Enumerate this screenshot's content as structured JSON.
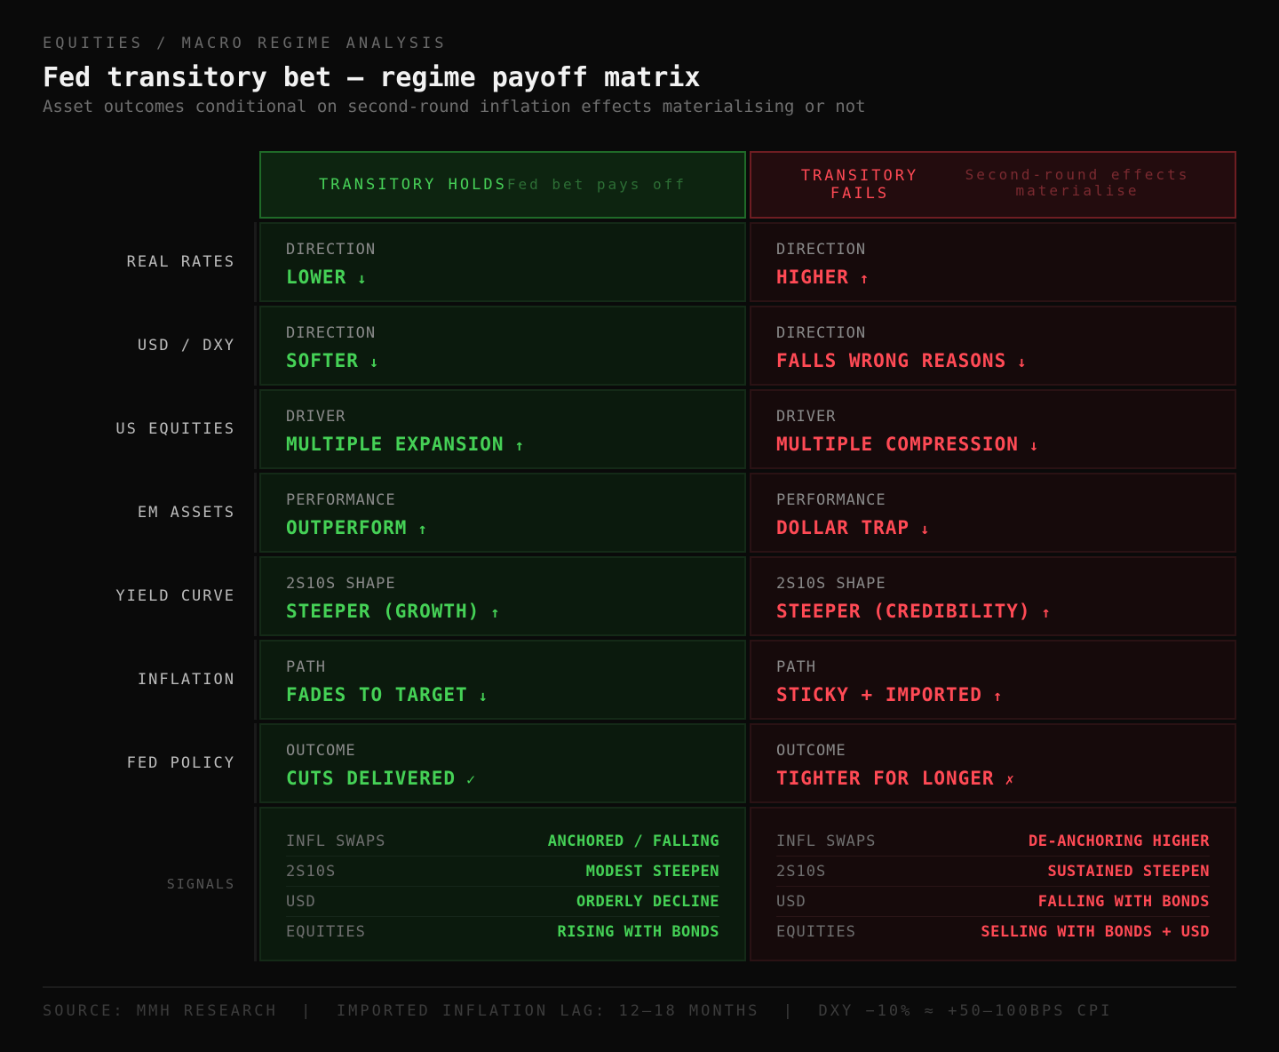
{
  "header": {
    "eyebrow": "EQUITIES / MACRO REGIME ANALYSIS",
    "title": "Fed transitory bet — regime payoff matrix",
    "subtitle": "Asset outcomes conditional on second-round inflation effects materialising or not"
  },
  "columns": {
    "holds": {
      "label": "TRANSITORY HOLDS",
      "sub": "Fed bet pays off"
    },
    "fails": {
      "label": "TRANSITORY FAILS",
      "sub": "Second-round effects materialise"
    }
  },
  "rows": [
    {
      "label": "REAL RATES",
      "holds": {
        "key": "DIRECTION",
        "value": "LOWER",
        "arrow": "↓"
      },
      "fails": {
        "key": "DIRECTION",
        "value": "HIGHER",
        "arrow": "↑"
      }
    },
    {
      "label": "USD / DXY",
      "holds": {
        "key": "DIRECTION",
        "value": "SOFTER",
        "arrow": "↓"
      },
      "fails": {
        "key": "DIRECTION",
        "value": "FALLS WRONG REASONS",
        "arrow": "↓"
      }
    },
    {
      "label": "US EQUITIES",
      "holds": {
        "key": "DRIVER",
        "value": "MULTIPLE EXPANSION",
        "arrow": "↑"
      },
      "fails": {
        "key": "DRIVER",
        "value": "MULTIPLE COMPRESSION",
        "arrow": "↓"
      }
    },
    {
      "label": "EM ASSETS",
      "holds": {
        "key": "PERFORMANCE",
        "value": "OUTPERFORM",
        "arrow": "↑"
      },
      "fails": {
        "key": "PERFORMANCE",
        "value": "DOLLAR TRAP",
        "arrow": "↓"
      }
    },
    {
      "label": "YIELD CURVE",
      "holds": {
        "key": "2S10S SHAPE",
        "value": "STEEPER (GROWTH)",
        "arrow": "↑"
      },
      "fails": {
        "key": "2S10S SHAPE",
        "value": "STEEPER (CREDIBILITY)",
        "arrow": "↑"
      }
    },
    {
      "label": "INFLATION",
      "holds": {
        "key": "PATH",
        "value": "FADES TO TARGET",
        "arrow": "↓"
      },
      "fails": {
        "key": "PATH",
        "value": "STICKY + IMPORTED",
        "arrow": "↑"
      }
    },
    {
      "label": "FED POLICY",
      "holds": {
        "key": "OUTCOME",
        "value": "CUTS DELIVERED",
        "arrow": "✓"
      },
      "fails": {
        "key": "OUTCOME",
        "value": "TIGHTER FOR LONGER",
        "arrow": "✗"
      }
    }
  ],
  "signals": {
    "label": "SIGNALS",
    "holds": [
      {
        "key": "INFL SWAPS",
        "value": "ANCHORED / FALLING"
      },
      {
        "key": "2S10S",
        "value": "MODEST STEEPEN"
      },
      {
        "key": "USD",
        "value": "ORDERLY DECLINE"
      },
      {
        "key": "EQUITIES",
        "value": "RISING WITH BONDS"
      }
    ],
    "fails": [
      {
        "key": "INFL SWAPS",
        "value": "DE-ANCHORING HIGHER"
      },
      {
        "key": "2S10S",
        "value": "SUSTAINED STEEPEN"
      },
      {
        "key": "USD",
        "value": "FALLING WITH BONDS"
      },
      {
        "key": "EQUITIES",
        "value": "SELLING WITH BONDS + USD"
      }
    ]
  },
  "footer": {
    "text": "SOURCE: MMH RESEARCH  |  IMPORTED INFLATION LAG: 12–18 MONTHS  |  DXY −10% ≈ +50–100BPS CPI"
  },
  "colors": {
    "accent_green": "#45d156",
    "accent_red": "#ff4a55",
    "background": "#0a0a0a"
  }
}
